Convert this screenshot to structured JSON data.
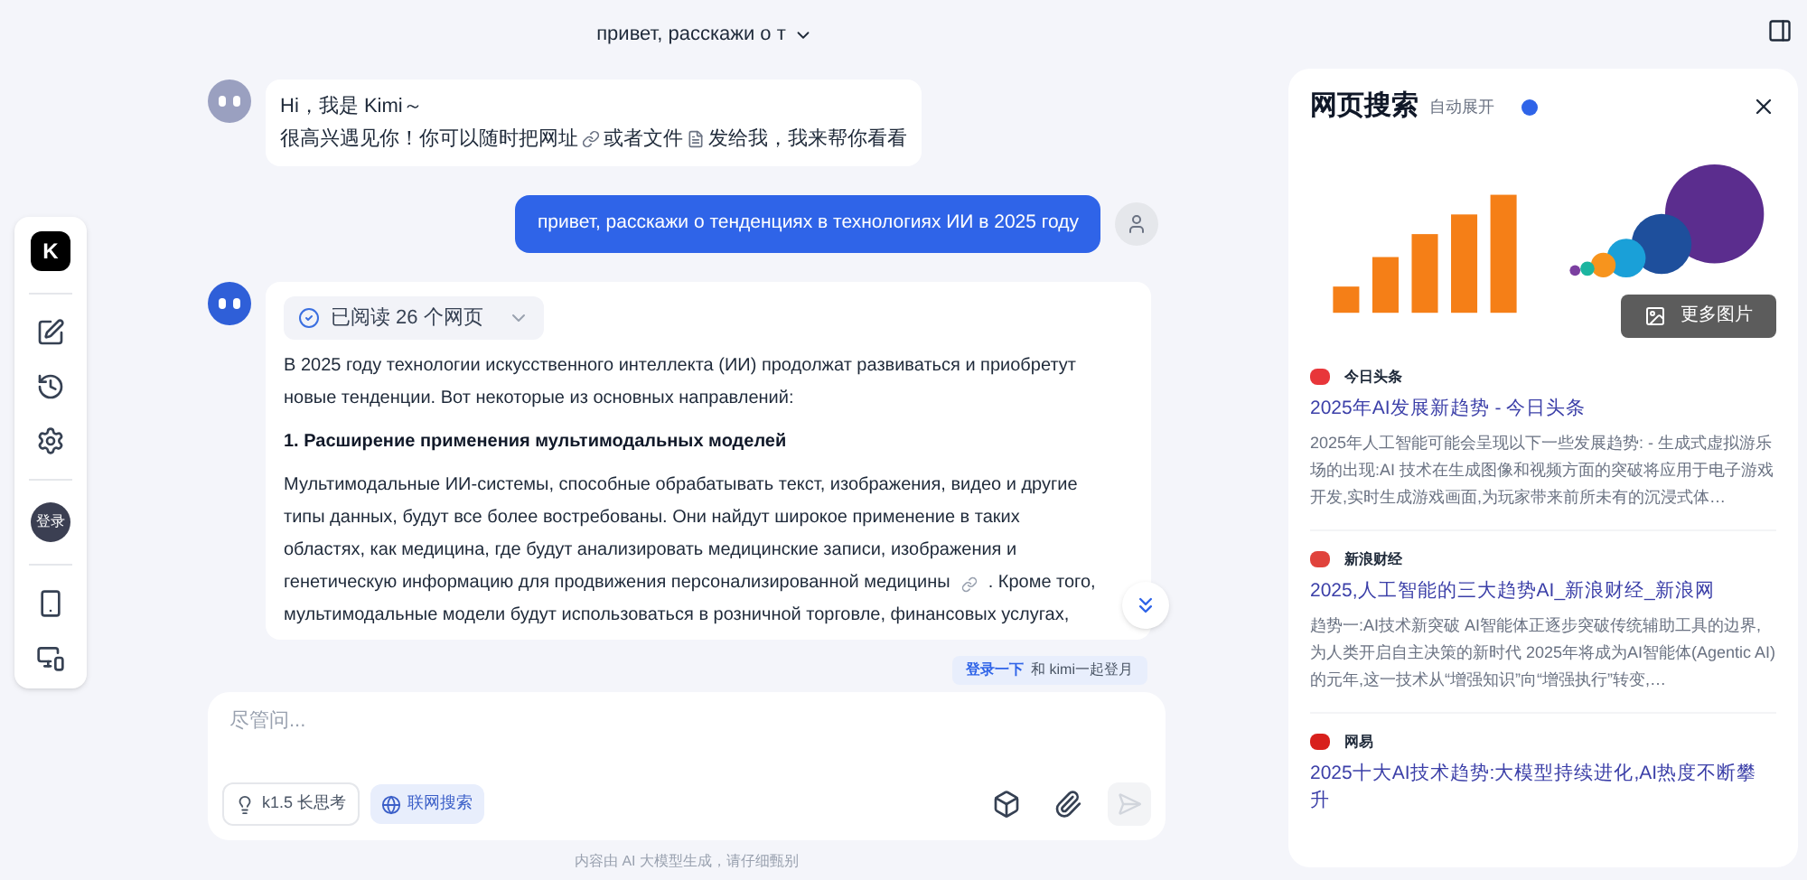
{
  "header": {
    "title": "привет, расскажи о т"
  },
  "sidebar": {
    "logo": "K",
    "items": [
      {
        "kind": "new-chat"
      },
      {
        "kind": "history"
      },
      {
        "kind": "apps"
      },
      {
        "kind": "login",
        "label": "登录"
      },
      {
        "kind": "phone"
      },
      {
        "kind": "desktop"
      }
    ]
  },
  "messages": [
    {
      "kind": "greeting",
      "lines": [
        {
          "segments": [
            "Hi，我是 Kimi～"
          ]
        },
        {
          "segments": [
            "很高兴遇见你！你可以随时把网址",
            "或者文件",
            "发给我，我来帮你看看"
          ]
        }
      ]
    },
    {
      "kind": "user",
      "text": "привет, расскажи о тенденциях в технологиях ИИ в 2025 году"
    },
    {
      "kind": "answer",
      "read_badge": "已阅读 26 个网页",
      "blocks": [
        {
          "kind": "paragraph",
          "segments": [
            "В 2025 году технологии искусственного интеллекта (ИИ) продолжат развиваться и приобретут новые тенденции. Вот некоторые из основных направлений:"
          ]
        },
        {
          "kind": "heading",
          "segments": [
            "1. Расширение применения мультимодальных моделей"
          ]
        },
        {
          "kind": "cited-paragraph",
          "lines": [
            {
              "segments": [
                "Мультимодальные ИИ-системы, способные обрабатывать текст, изображения, видео и другие типы данных, будут все более востребованы. Они найдут широкое применение в таких областях, как медицина, где будут анализировать медицинские записи, изображения и"
              ]
            },
            {
              "segments": [
                "генетическую информацию для продвижения персонализированной медицины",
                ". Кроме того,"
              ]
            },
            {
              "segments": [
                "мультимодальные модели будут использоваться в розничной торговле, финансовых услугах,"
              ]
            }
          ]
        }
      ]
    }
  ],
  "login_hint": {
    "link": "登录一下",
    "text": "和 kimi一起登月"
  },
  "composer": {
    "placeholder": "尽管问...",
    "chips": [
      {
        "label": "k1.5 长思考",
        "selected": false
      },
      {
        "label": "联网搜索",
        "selected": true
      }
    ]
  },
  "footer_note": "内容由 AI 大模型生成，请仔细甄别",
  "search_panel": {
    "title": "网页搜索",
    "auto_expand_label": "自动展开",
    "auto_expand_on": true,
    "more_images": "更多图片",
    "results": [
      {
        "source": "今日头条",
        "color": "#e8363a",
        "title": "2025年AI发展新趋势 - 今日头条",
        "snippet": "2025年人工智能可能会呈现以下一些发展趋势: - 生成式虚拟游乐场的出现:AI 技术在生成图像和视频方面的突破将应用于电子游戏开发,实时生成游戏画面,为玩家带来前所未有的沉浸式体…"
      },
      {
        "source": "新浪财经",
        "color": "#e0433c",
        "title": "2025,人工智能的三大趋势AI_新浪财经_新浪网",
        "snippet": "趋势一:AI技术新突破 AI智能体正逐步突破传统辅助工具的边界,为人类开启自主决策的新时代 2025年将成为AI智能体(Agentic AI)的元年,这一技术从“增强知识”向“增强执行”转变,…"
      },
      {
        "source": "网易",
        "color": "#d8201c",
        "title": "2025十大AI技术趋势:大模型持续进化,AI热度不断攀升"
      }
    ]
  }
}
